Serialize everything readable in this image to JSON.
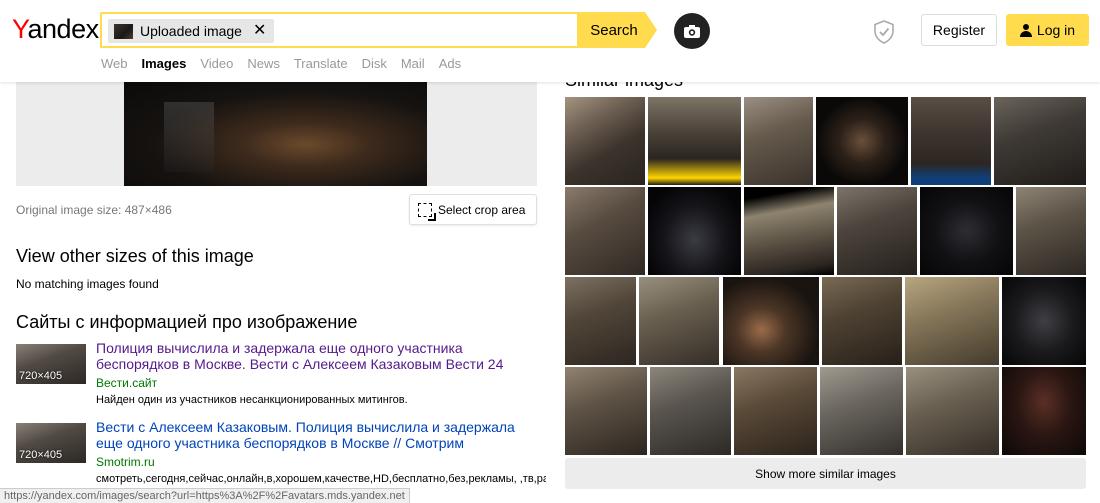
{
  "header": {
    "logo_first": "Y",
    "logo_rest": "andex",
    "chip_label": "Uploaded image",
    "chip_close": "✕",
    "search_label": "Search",
    "register_label": "Register",
    "login_label": "Log in"
  },
  "nav": [
    "Web",
    "Images",
    "Video",
    "News",
    "Translate",
    "Disk",
    "Mail",
    "Ads"
  ],
  "left": {
    "original_size": "Original image size: 487×486",
    "crop_label": "Select crop area",
    "other_sizes_title": "View other sizes of this image",
    "no_matching": "No matching images found",
    "sites_title": "Сайты с информацией про изображение",
    "sites": [
      {
        "thumb_label": "720×405",
        "title": "Полиция вычислила и задержала еще одного участника беспорядков в Москве. Вести с Алексеем Казаковым Вести 24",
        "domain": "Вести.сайт",
        "desc": "Найден один из участников несанкционированных митингов."
      },
      {
        "thumb_label": "720×405",
        "title": "Вести с Алексеем Казаковым. Полиция вычислила и задержала еще одного участника беспорядков в Москве // Смотрим",
        "domain": "Smotrim.ru",
        "desc": "смотреть,сегодня,сейчас,онлайн,в,хорошем,качестве,HD,бесплатно,без,рекламы,  ,тв,радио,интернет,передача,п"
      }
    ]
  },
  "right": {
    "similar_title": "Similar images",
    "more_label": "Show more similar images"
  },
  "status_url": "https://yandex.com/images/search?url=https%3A%2F%2Favatars.mds.yandex.net",
  "colors": {
    "accent": "#ffdb4d",
    "logo_red": "#ff0000",
    "visited_link": "#551a8b",
    "link": "#0044bb",
    "domain_green": "#007700"
  }
}
